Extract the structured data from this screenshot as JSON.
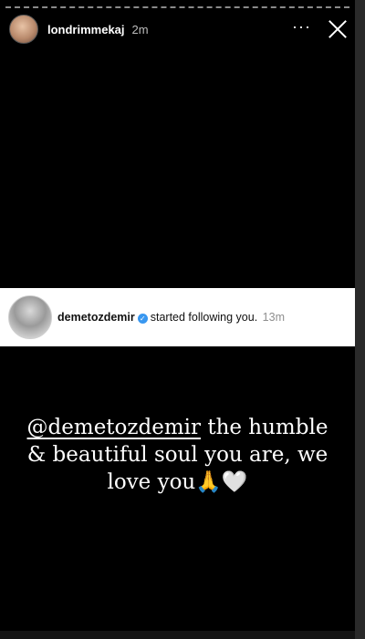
{
  "header": {
    "username": "londrimmekaj",
    "time": "2m",
    "more_label": "···",
    "avatar_icon": "profile-avatar-icon",
    "close_icon": "close-icon"
  },
  "notification": {
    "username": "demetozdemir",
    "verified_icon": "verified-badge-icon",
    "verified_glyph": "✓",
    "action": "started following you.",
    "time": "13m"
  },
  "caption": {
    "mention": "@demetozdemir",
    "line1_rest": " the humble",
    "line2": "& beautiful soul you are, we",
    "line3": "love you",
    "emoji": "🙏🤍"
  },
  "colors": {
    "background": "#000000",
    "notification_bg": "#ffffff",
    "verified": "#3897f0",
    "text": "#ffffff"
  }
}
